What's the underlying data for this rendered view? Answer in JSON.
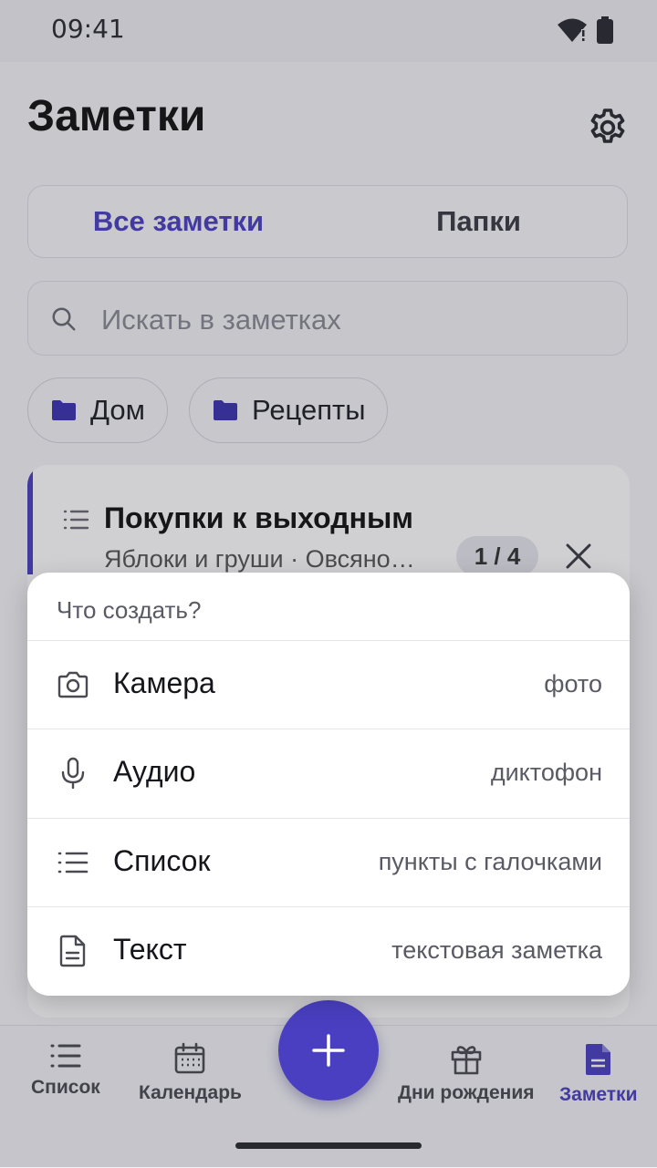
{
  "status_bar": {
    "time": "09:41"
  },
  "header": {
    "title": "Заметки"
  },
  "tabs": {
    "all": "Все заметки",
    "folders": "Папки"
  },
  "search": {
    "placeholder": "Искать в заметках"
  },
  "chips": [
    {
      "label": "Дом",
      "icon": "folder-icon"
    },
    {
      "label": "Рецепты",
      "icon": "folder-icon"
    }
  ],
  "note_card": {
    "title": "Покупки к выходным",
    "subtitle": "Яблоки и груши · Овсяно…",
    "badge": "1 / 4",
    "icon": "list-icon"
  },
  "sheet": {
    "title": "Что создать?",
    "options": [
      {
        "label": "Камера",
        "hint": "фото",
        "icon": "camera-icon"
      },
      {
        "label": "Аудио",
        "hint": "диктофон",
        "icon": "microphone-icon"
      },
      {
        "label": "Список",
        "hint": "пункты с галочками",
        "icon": "list-icon"
      },
      {
        "label": "Текст",
        "hint": "текстовая заметка",
        "icon": "document-icon"
      }
    ]
  },
  "bottom_nav": {
    "list": "Список",
    "calendar": "Календарь",
    "birthdays": "Дни рождения",
    "notes": "Заметки"
  },
  "colors": {
    "accent": "#4a3fc0",
    "background": "#f4f4f8",
    "sheet": "#ffffff"
  }
}
